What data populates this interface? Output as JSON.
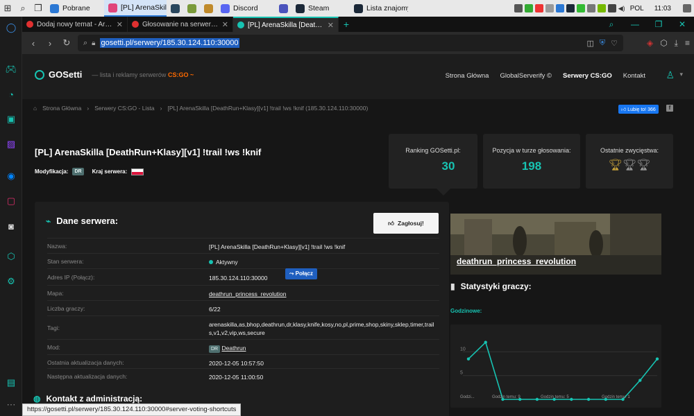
{
  "taskbar": {
    "apps": [
      {
        "label": "Pobrane",
        "color": "#2b78d4"
      },
      {
        "label": "[PL] ArenaSkil...",
        "color": "#e0457b"
      },
      {
        "label": "",
        "color": "#2a475e"
      },
      {
        "label": "",
        "color": "#7a9a3a"
      },
      {
        "label": "",
        "color": "#c08a2a"
      },
      {
        "label": "Discord",
        "color": "#5865f2"
      },
      {
        "label": "",
        "color": "#4b53bc"
      },
      {
        "label": "Steam",
        "color": "#1b2838"
      },
      {
        "label": "Lista znajomy...",
        "color": "#1b2838"
      }
    ],
    "lang": "POL",
    "time": "11:03"
  },
  "tabs": [
    {
      "label": "Dodaj nowy temat - ArenaSk",
      "color": "#e03030",
      "active": false
    },
    {
      "label": "Głosowanie na serwery CS:G",
      "color": "#e03030",
      "active": false
    },
    {
      "label": "[PL] ArenaSkilla [DeathRun+",
      "color": "#17c3b2",
      "active": true
    }
  ],
  "url": "gosetti.pl/serwery/185.30.124.110:30000",
  "site": {
    "logo": "GOSetti",
    "tagline_prefix": "— lista i reklamy serwerów",
    "tagline_game": "CS:GO",
    "nav": [
      "Strona Główna",
      "GlobalServerify ©",
      "Serwery CS:GO",
      "Kontakt"
    ]
  },
  "breadcrumb": [
    "Strona Główna",
    "Serwery CS:GO - Lista",
    "[PL] ArenaSkilla [DeathRun+Klasy][v1] !trail !ws !knif (185.30.124.110:30000)"
  ],
  "like_label": "Lubię to! 366",
  "server": {
    "title": "[PL] ArenaSkilla [DeathRun+Klasy][v1] !trail !ws !knif",
    "mod_label": "Modyfikacja:",
    "mod_badge": "DR",
    "country_label": "Kraj serwera:"
  },
  "stats_cards": [
    {
      "label": "Ranking GOSetti.pl:",
      "value": "30"
    },
    {
      "label": "Pozycja w turze głosowania:",
      "value": "198"
    },
    {
      "label": "Ostatnie zwycięstwa:",
      "value": ""
    }
  ],
  "panel": {
    "title": "Dane serwera:",
    "vote_label": "Zagłosuj!",
    "connect_label": "Połącz",
    "rows": [
      {
        "key": "Nazwa:",
        "value": "[PL] ArenaSkilla [DeathRun+Klasy][v1] !trail !ws !knif"
      },
      {
        "key": "Stan serwera:",
        "value": "Aktywny"
      },
      {
        "key": "Adres IP (Połącz):",
        "value": "185.30.124.110:30000"
      },
      {
        "key": "Mapa:",
        "value": "deathrun_princess_revolution"
      },
      {
        "key": "Liczba graczy:",
        "value": "6/22"
      },
      {
        "key": "Tagi:",
        "value": "arenaskilla,as,bhop,deathrun,dr,klasy,knife,kosy,no,pl,prime,shop,skiny,sklep,timer,trails,v1,v2,vip,ws,secure"
      },
      {
        "key": "Mod:",
        "value": "Deathrun",
        "badge": "DR"
      },
      {
        "key": "Ostatnia aktualizacja danych:",
        "value": "2020-12-05 10:57:50"
      },
      {
        "key": "Następna aktualizacja danych:",
        "value": "2020-12-05 11:00:50"
      }
    ],
    "contact_title": "Kontakt z administracją:"
  },
  "map_name": "deathrun_princess_revolution",
  "stats_title": "Statystyki graczy:",
  "hourly_label": "Godzinowe:",
  "chart_data": {
    "type": "line",
    "y_ticks": [
      "10",
      "5"
    ],
    "x_labels": [
      "Godzi...",
      "Godzin temu: 9",
      "Godzin temu: 5",
      "Godzin temu: 1"
    ],
    "values": [
      8.5,
      12,
      0,
      0,
      0,
      0,
      0,
      0,
      0,
      0,
      4,
      8.5
    ],
    "ylim": [
      0,
      14
    ],
    "color": "#17c3b2"
  },
  "status_url": "https://gosetti.pl/serwery/185.30.124.110:30000#server-voting-shortcuts",
  "colors": {
    "accent": "#17c3b2",
    "brand_orange": "#ff6a00"
  }
}
